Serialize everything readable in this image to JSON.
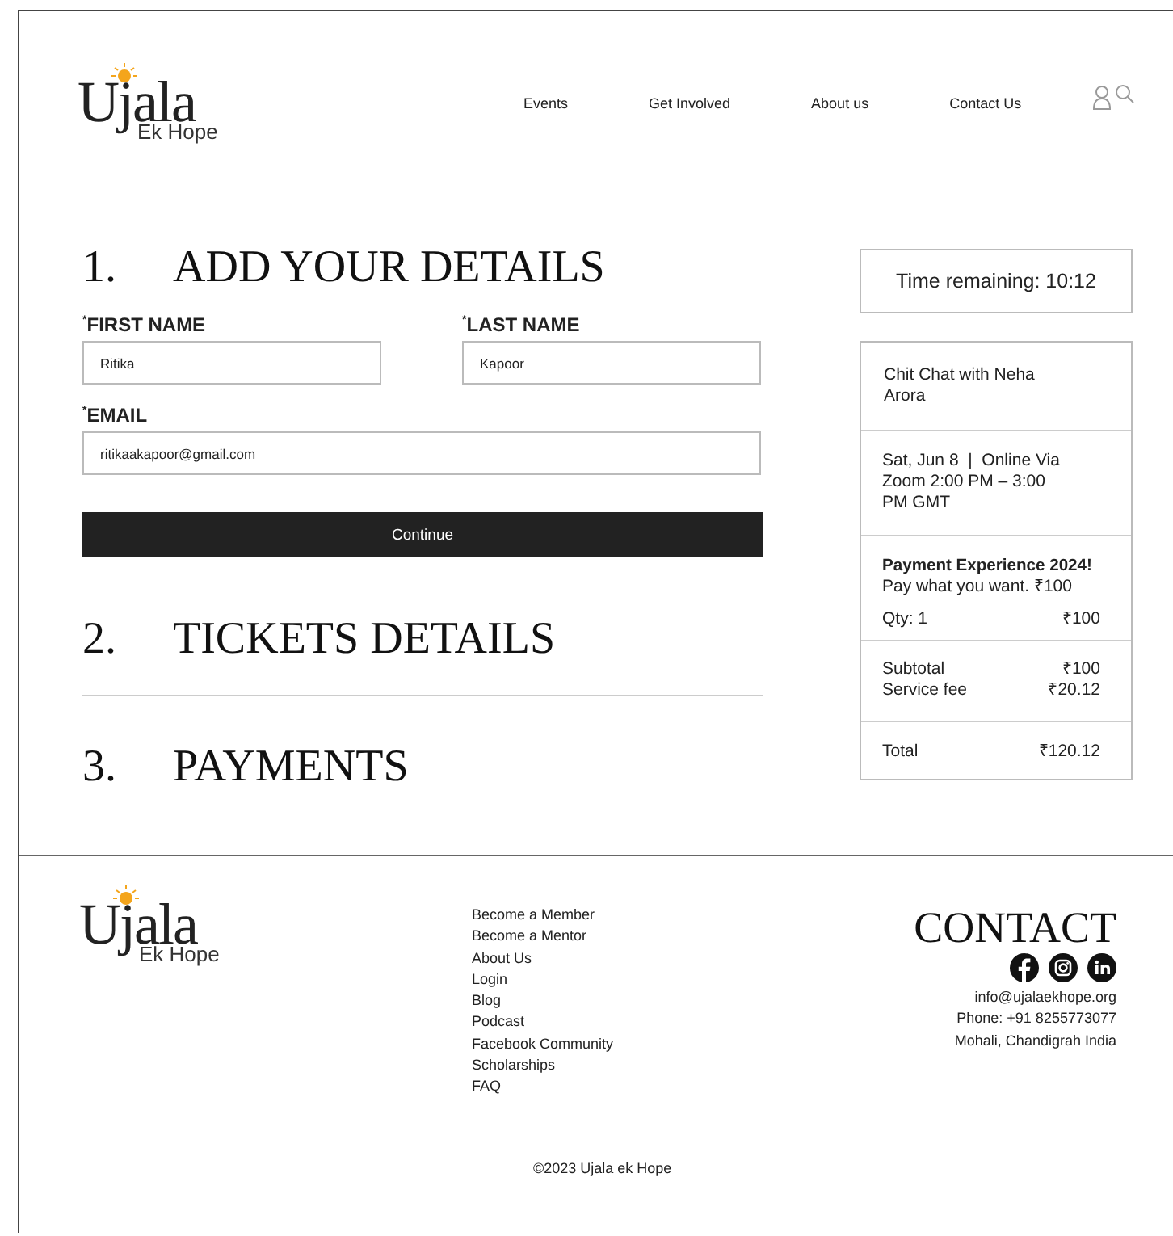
{
  "header": {
    "logo": {
      "name": "Ujala",
      "tagline": "Ek Hope"
    },
    "nav": [
      {
        "label": "Events"
      },
      {
        "label": "Get Involved"
      },
      {
        "label": "About us"
      },
      {
        "label": "Contact Us"
      }
    ]
  },
  "sections": [
    {
      "number": "1.",
      "title": "ADD YOUR DETAILS"
    },
    {
      "number": "2.",
      "title": "TICKETS DETAILS"
    },
    {
      "number": "3.",
      "title": "PAYMENTS"
    }
  ],
  "form": {
    "fields": [
      {
        "label": "$^{*}$FIRST NAME",
        "value": "Ritika",
        "wide": false
      },
      {
        "label": "$^{*}$LAST NAME",
        "value": "Kapoor",
        "wide": false
      },
      {
        "label": "$^{*}$EMAIL",
        "value": "ritikaakapoor@gmail.com",
        "wide": true
      }
    ],
    "button": "Continue"
  },
  "summary": {
    "timer": "Time remaining: 10:12",
    "event": "Chit Chat with Neha Arora",
    "details": "Sat, Jun 8  |  Online Via Zoom 2:00 PM – 3:00 PM GMT",
    "ticket": {
      "name": "Payment Experience 2024!",
      "price": "Pay what you want. ₹100",
      "qty": "Qty: 1",
      "amount": "₹100"
    },
    "charges": [
      {
        "label": "Subtotal",
        "amount": "₹100"
      },
      {
        "label": "Service fee",
        "amount": "₹20.12"
      }
    ],
    "total": {
      "label": "Total",
      "amount": "₹120.12"
    }
  },
  "footer": {
    "logo": {
      "name": "Ujala",
      "tagline": "Ek Hope"
    },
    "links": [
      "Become a Member",
      "Become a Mentor",
      "About Us",
      "Login",
      "Blog",
      "Podcast",
      "Facebook Community",
      "Scholarships",
      "FAQ"
    ],
    "contact": {
      "title": "CONTACT",
      "social": [
        {
          "kind": "facebook"
        },
        {
          "kind": "instagram"
        },
        {
          "kind": "linkedin"
        }
      ],
      "lines": [
        "info@ujalaekhope.org",
        "Phone: +91 8255773077",
        "Mohali, Chandigrah India"
      ]
    },
    "copyright": "©2023 Ujala ek Hope"
  }
}
